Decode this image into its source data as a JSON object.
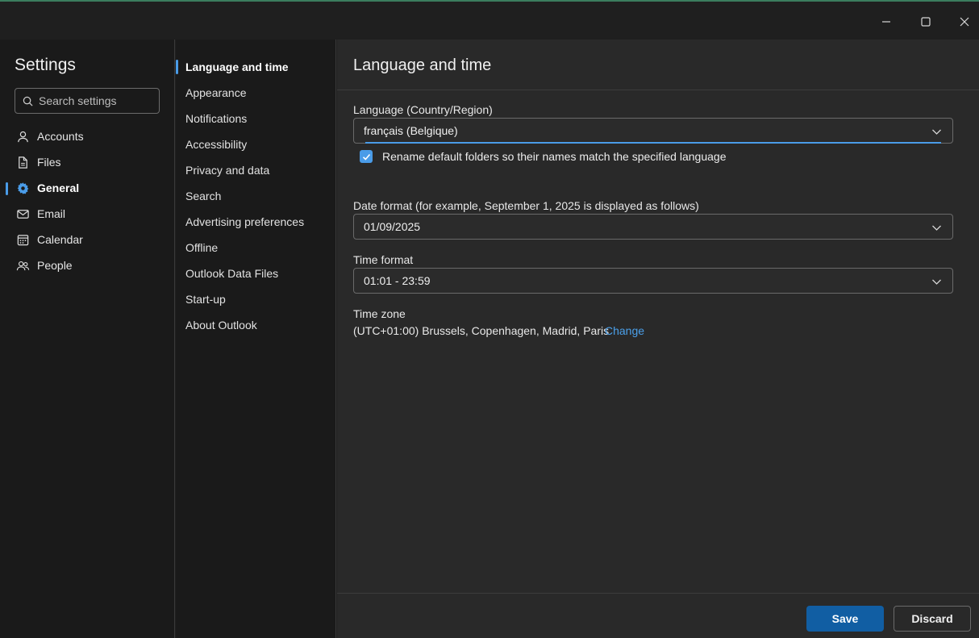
{
  "window": {
    "minimize_icon": "minimize-icon",
    "maximize_icon": "maximize-icon",
    "close_icon": "close-icon"
  },
  "settings": {
    "title": "Settings",
    "search_placeholder": "Search settings",
    "categories": [
      {
        "label": "Accounts",
        "icon": "person-icon"
      },
      {
        "label": "Files",
        "icon": "file-icon"
      },
      {
        "label": "General",
        "icon": "gear-icon",
        "active": true
      },
      {
        "label": "Email",
        "icon": "mail-icon"
      },
      {
        "label": "Calendar",
        "icon": "calendar-icon"
      },
      {
        "label": "People",
        "icon": "people-icon"
      }
    ]
  },
  "general_nav": {
    "items": [
      {
        "label": "Language and time",
        "active": true
      },
      {
        "label": "Appearance"
      },
      {
        "label": "Notifications"
      },
      {
        "label": "Accessibility"
      },
      {
        "label": "Privacy and data"
      },
      {
        "label": "Search"
      },
      {
        "label": "Advertising preferences"
      },
      {
        "label": "Offline"
      },
      {
        "label": "Outlook Data Files"
      },
      {
        "label": "Start-up"
      },
      {
        "label": "About Outlook"
      }
    ]
  },
  "main": {
    "title": "Language and time",
    "language": {
      "label": "Language (Country/Region)",
      "value": "français (Belgique)"
    },
    "rename_folders": {
      "checked": true,
      "label": "Rename default folders so their names match the specified language"
    },
    "date_format": {
      "label": "Date format (for example, September 1, 2025 is displayed as follows)",
      "value": "01/09/2025"
    },
    "time_format": {
      "label": "Time format",
      "value": "01:01 - 23:59"
    },
    "time_zone": {
      "label": "Time zone",
      "value": "(UTC+01:00) Brussels, Copenhagen, Madrid, Paris",
      "change_link": "Change"
    }
  },
  "footer": {
    "save_label": "Save",
    "discard_label": "Discard"
  },
  "colors": {
    "accent": "#4a9ce8",
    "primary_button": "#115ea3",
    "link": "#4ba0ea"
  }
}
